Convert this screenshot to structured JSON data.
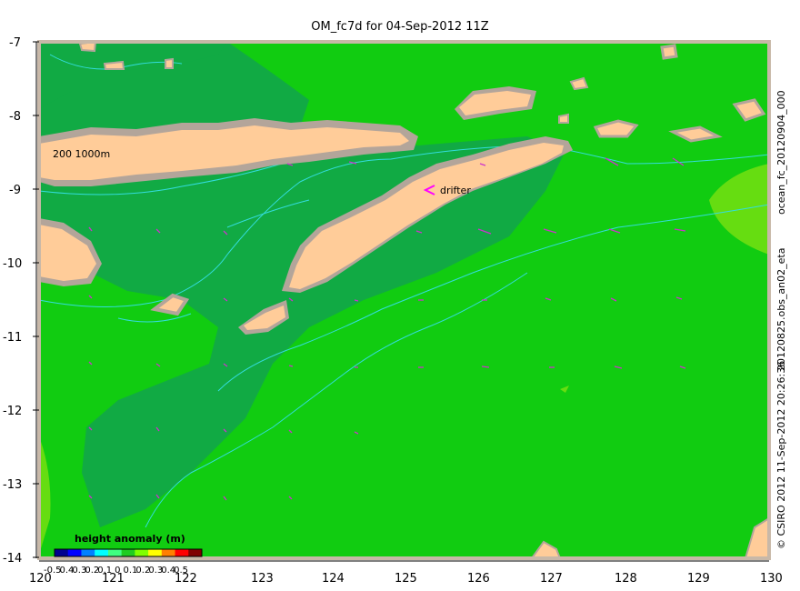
{
  "title": "OM_fc7d for 04-Sep-2012 11Z",
  "map": {
    "lon_range": [
      120,
      130
    ],
    "lat_range": [
      -14,
      -7
    ],
    "x_ticks": [
      "120",
      "121",
      "122",
      "123",
      "124",
      "125",
      "126",
      "127",
      "128",
      "129",
      "130"
    ],
    "y_ticks": [
      "-7",
      "-8",
      "-9",
      "-10",
      "-11",
      "-12",
      "-13",
      "-14"
    ],
    "contour_label": "200  1000m",
    "drifter_label": "drifter",
    "colors": {
      "land": "#ffcc99",
      "shelf": "#b3a59a",
      "sea": "#11cc11",
      "sea_dark": "#11aa44",
      "contour": "#33dddd",
      "arrow": "#cc33cc",
      "border": "#c8b8a8"
    }
  },
  "legend": {
    "title": "height anomaly  (m)",
    "labels": [
      "-0.5",
      "0.4",
      "0.3",
      "0.2",
      "0.1",
      "0",
      "0.1",
      "0.2",
      "0.3",
      "0.4",
      "0.5"
    ],
    "colormap": [
      "#00008f",
      "#0000ff",
      "#0080ff",
      "#00ffff",
      "#40ff80",
      "#20cc20",
      "#80ff00",
      "#ffff00",
      "#ff8000",
      "#ff0000",
      "#800000"
    ]
  },
  "side_text": {
    "right_top": "ocean_fc_20120904_000",
    "right_mid": "20120825.obs_an02_eta",
    "right_bottom": "©  CSIRO 2012   11-Sep-2012 20:26:36"
  }
}
